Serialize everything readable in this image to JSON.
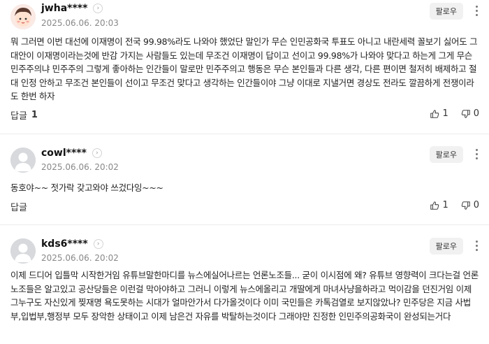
{
  "comments": [
    {
      "username": "jwha****",
      "date": "2025.06.06. 20:03",
      "follow_label": "팔로우",
      "text": "뭐 그러면 이번 대선에 이재명이 전국 99.98%라도 나와야 했었단 말인가 무슨 인민공화국 투표도 아니고 내란세력 꼴보기 싫어도 그 대안이 이재명이라는것에 반감 가지는 사람들도 있는데 무조건 이재명이 답이고 선이고 99.98%가 나와야 맞다고 하는게 그게 무슨 민주주의냐 민주주의 그렇게 좋아하는 인간들이 말로만 민주주의고 행동은 무슨 본인들과 다른 생각, 다른 편이면 철저히 배제하고 절대 인정 안하고 무조건 본인들이 선이고 무조건 맞다고 생각하는 인간들이야 그냥 이대로 지낼거면 경상도 전라도 깔끔하게 전쟁이라도 한번 하자",
      "reply_label": "답글",
      "reply_count": "1",
      "like_count": "1",
      "dislike_count": "0"
    },
    {
      "username": "cowl****",
      "date": "2025.06.06. 20:02",
      "follow_label": "팔로우",
      "text": "동호야~~ 젓가락 갖고와야 쓰겄다잉~~~",
      "reply_label": "답글",
      "like_count": "1",
      "dislike_count": "0"
    },
    {
      "username": "kds6****",
      "date": "2025.06.06. 20:02",
      "follow_label": "팔로우",
      "text": "이제 드디어 입틀막 시작한거임 유튜브말한마디를 뉴스에실어나르는 언론노조들... 굳이 이시점에 왜? 유튜브 영향력이 크다는걸 언론노조들은 알고있고 공산당들은 이런걸 막아야하고 그러니 이렇게 뉴스에올리고 개딸에게 마녀사냥을하라고 먹이감을 던진거임 이제 그누구도 자신있게 찢재명 욕도못하는 시대가 얼마안가서 다가올것이다 이미 국민들은 카톡검열로 보지않았나? 민주당은 지금 사법부,입법부,행정부 모두 장악한 상태이고 이제 남은건 자유를 박탈하는것이다 그래야만 진정한 인민주의공화국이 완성되는거다"
    }
  ],
  "icons": {
    "chevron": "chevron-right-icon",
    "more": "more-vertical-icon",
    "like": "thumbs-up-icon",
    "dislike": "thumbs-down-icon",
    "avatar_default": "default-user-avatar",
    "avatar_custom": "cartoon-face-avatar"
  },
  "colors": {
    "text": "#222222",
    "meta": "#888888",
    "button_bg": "#f1f1f1",
    "divider": "#ececec"
  }
}
